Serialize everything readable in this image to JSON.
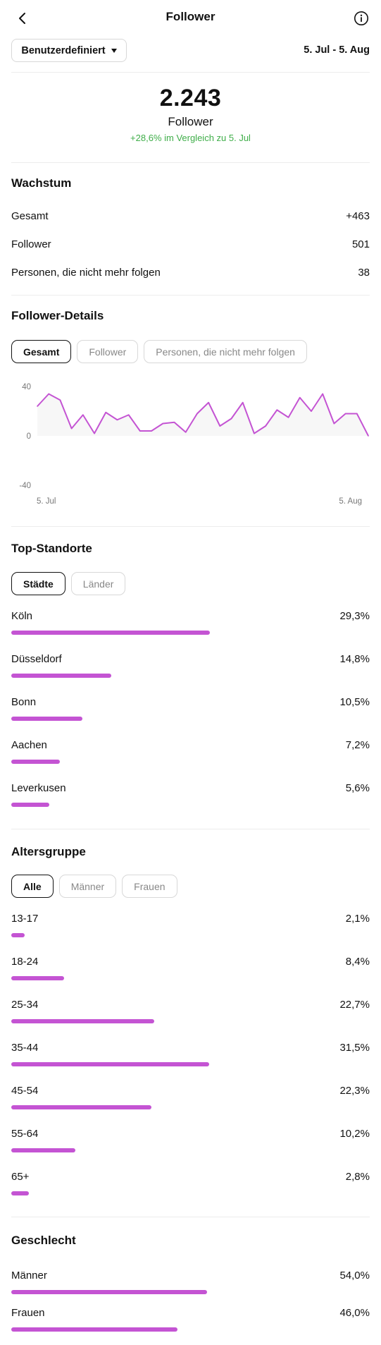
{
  "header": {
    "title": "Follower",
    "back_icon": "chevron-left-icon",
    "info_icon": "info-icon"
  },
  "filter": {
    "range_label": "Benutzerdefiniert",
    "date_range": "5. Jul - 5. Aug"
  },
  "summary": {
    "value": "2.243",
    "label": "Follower",
    "change": "+28,6% im Vergleich zu 5. Jul"
  },
  "growth": {
    "title": "Wachstum",
    "rows": [
      {
        "label": "Gesamt",
        "value": "+463"
      },
      {
        "label": "Follower",
        "value": "501"
      },
      {
        "label": "Personen, die nicht mehr folgen",
        "value": "38"
      }
    ]
  },
  "details": {
    "title": "Follower-Details",
    "tabs": [
      "Gesamt",
      "Follower",
      "Personen, die nicht mehr folgen"
    ],
    "active_tab": 0
  },
  "chart_data": {
    "type": "line",
    "color": "#c454d3",
    "y_ticks": [
      "40",
      "0",
      "-40"
    ],
    "ylim": [
      -40,
      40
    ],
    "x_start_label": "5. Jul",
    "x_end_label": "5. Aug",
    "values": [
      24,
      34,
      29,
      6,
      17,
      2,
      19,
      13,
      17,
      4,
      4,
      10,
      11,
      3,
      18,
      27,
      8,
      14,
      27,
      2,
      8,
      21,
      15,
      31,
      20,
      34,
      10,
      18,
      18,
      0
    ]
  },
  "locations": {
    "title": "Top-Standorte",
    "tabs": [
      "Städte",
      "Länder"
    ],
    "active_tab": 0,
    "items": [
      {
        "label": "Köln",
        "value": "29,3%",
        "pct": 29.3
      },
      {
        "label": "Düsseldorf",
        "value": "14,8%",
        "pct": 14.8
      },
      {
        "label": "Bonn",
        "value": "10,5%",
        "pct": 10.5
      },
      {
        "label": "Aachen",
        "value": "7,2%",
        "pct": 7.2
      },
      {
        "label": "Leverkusen",
        "value": "5,6%",
        "pct": 5.6
      }
    ]
  },
  "age": {
    "title": "Altersgruppe",
    "tabs": [
      "Alle",
      "Männer",
      "Frauen"
    ],
    "active_tab": 0,
    "items": [
      {
        "label": "13-17",
        "value": "2,1%",
        "pct": 2.1
      },
      {
        "label": "18-24",
        "value": "8,4%",
        "pct": 8.4
      },
      {
        "label": "25-34",
        "value": "22,7%",
        "pct": 22.7
      },
      {
        "label": "35-44",
        "value": "31,5%",
        "pct": 31.5
      },
      {
        "label": "45-54",
        "value": "22,3%",
        "pct": 22.3
      },
      {
        "label": "55-64",
        "value": "10,2%",
        "pct": 10.2
      },
      {
        "label": "65+",
        "value": "2,8%",
        "pct": 2.8
      }
    ]
  },
  "gender": {
    "title": "Geschlecht",
    "items": [
      {
        "label": "Männer",
        "value": "54,0%",
        "pct": 54.0
      },
      {
        "label": "Frauen",
        "value": "46,0%",
        "pct": 46.0
      }
    ]
  }
}
